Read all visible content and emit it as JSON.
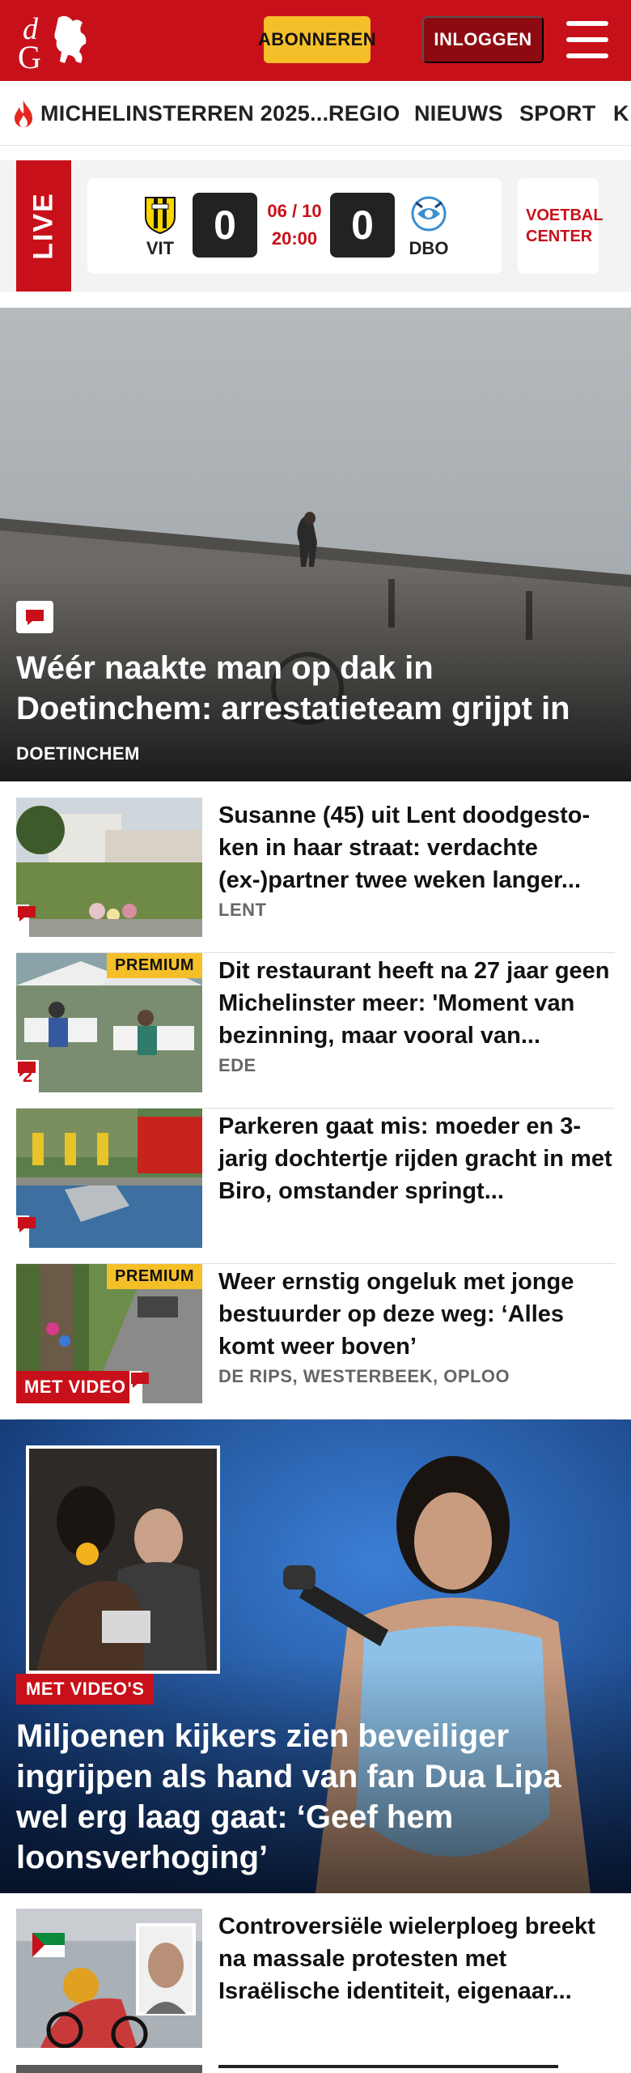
{
  "header": {
    "logo_text": "dG",
    "subscribe_label": "ABONNEREN",
    "login_label": "INLOGGEN",
    "brand_color": "#c8101a"
  },
  "nav": {
    "items": [
      {
        "label": "MICHELINSTERREN 2025..."
      },
      {
        "label": "REGIO"
      },
      {
        "label": "NIEUWS"
      },
      {
        "label": "SPORT"
      },
      {
        "label": "K"
      }
    ]
  },
  "live": {
    "label": "LIVE",
    "home_team": "VIT",
    "away_team": "DBO",
    "home_score": "0",
    "away_score": "0",
    "date": "06 / 10",
    "time": "20:00",
    "center_label": "VOETBAL CENTER"
  },
  "hero": {
    "title": "Wéér naakte man op dak in Doetinchem: arrestatieteam grijpt in",
    "kicker": "DOETINCHEM"
  },
  "articles": [
    {
      "title": "Susanne (45) uit Lent doodgesto­ken in haar straat: verdachte (ex-)partner twee weken langer...",
      "location": "LENT",
      "premium": "",
      "comments": "",
      "video": ""
    },
    {
      "title": "Dit restaurant heeft na 27 jaar geen Michelinster meer: 'Moment van bezinning, maar vooral van...",
      "location": "EDE",
      "premium": "PREMIUM",
      "comments": "2",
      "video": ""
    },
    {
      "title": "Parkeren gaat mis: moeder en 3-jarig dochtertje rijden gracht in met Biro, omstander springt...",
      "location": "",
      "premium": "",
      "comments": "",
      "video": ""
    },
    {
      "title": "Weer ernstig ongeluk met jonge bestuurder op deze weg: ‘Alles komt weer boven’",
      "location": "DE RIPS, WESTERBEEK, OPLOO",
      "premium": "PREMIUM",
      "comments": "",
      "video": "MET VIDEO"
    }
  ],
  "feature": {
    "badge": "MET VIDEO'S",
    "title": "Miljoenen kijkers zien beveiliger ingrijpen als hand van fan Dua Lipa wel erg laag gaat: ‘Geef hem loonsverhoging’"
  },
  "last_article": {
    "title": "Controversiële wielerploeg breekt na massale protesten met Israëlische identiteit, eigenaar..."
  }
}
